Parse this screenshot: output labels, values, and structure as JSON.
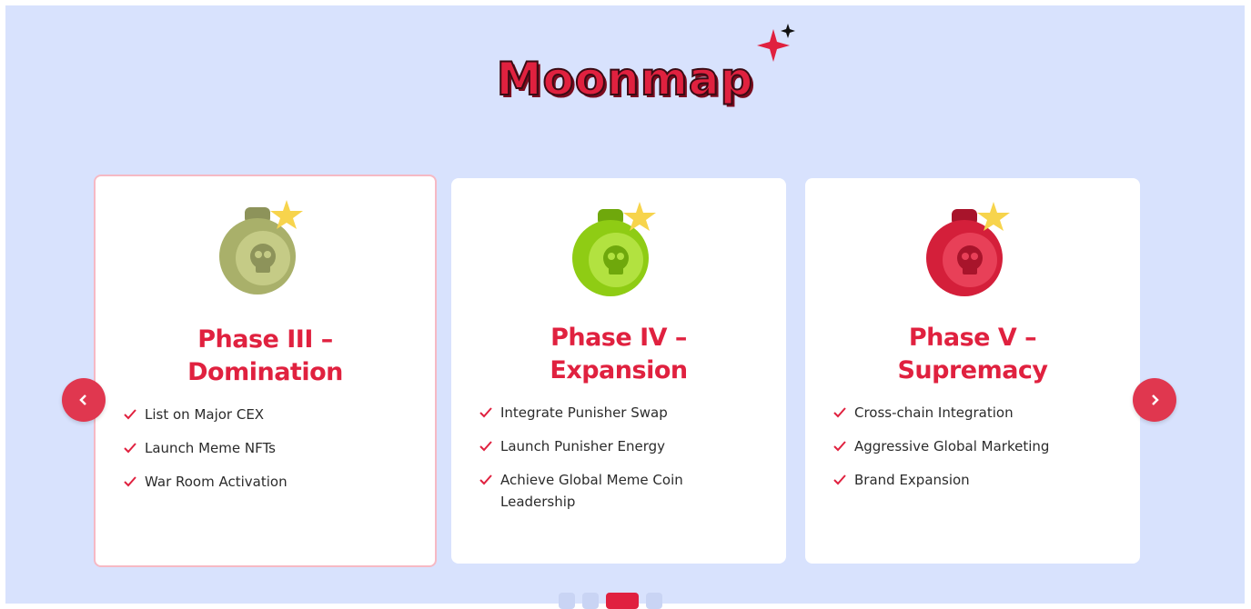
{
  "section": {
    "title": "Moonmap"
  },
  "nav": {
    "prev_icon": "chevron-left-icon",
    "next_icon": "chevron-right-icon"
  },
  "cards": [
    {
      "title_line1": "Phase III –",
      "title_line2": "Domination",
      "bomb_color": "#a9b06a",
      "items": [
        "List on Major CEX",
        "Launch Meme NFTs",
        "War Room Activation"
      ]
    },
    {
      "title_line1": "Phase IV –",
      "title_line2": "Expansion",
      "bomb_color": "#8fcc14",
      "items": [
        "Integrate Punisher Swap",
        "Launch Punisher Energy",
        "Achieve Global Meme Coin Leadership"
      ]
    },
    {
      "title_line1": "Phase V –",
      "title_line2": "Supremacy",
      "bomb_color": "#d41f3a",
      "items": [
        "Cross-chain Integration",
        "Aggressive Global Marketing",
        "Brand Expansion"
      ]
    }
  ],
  "colors": {
    "accent": "#e0213f",
    "background": "#d8e2fd",
    "card": "#ffffff"
  }
}
